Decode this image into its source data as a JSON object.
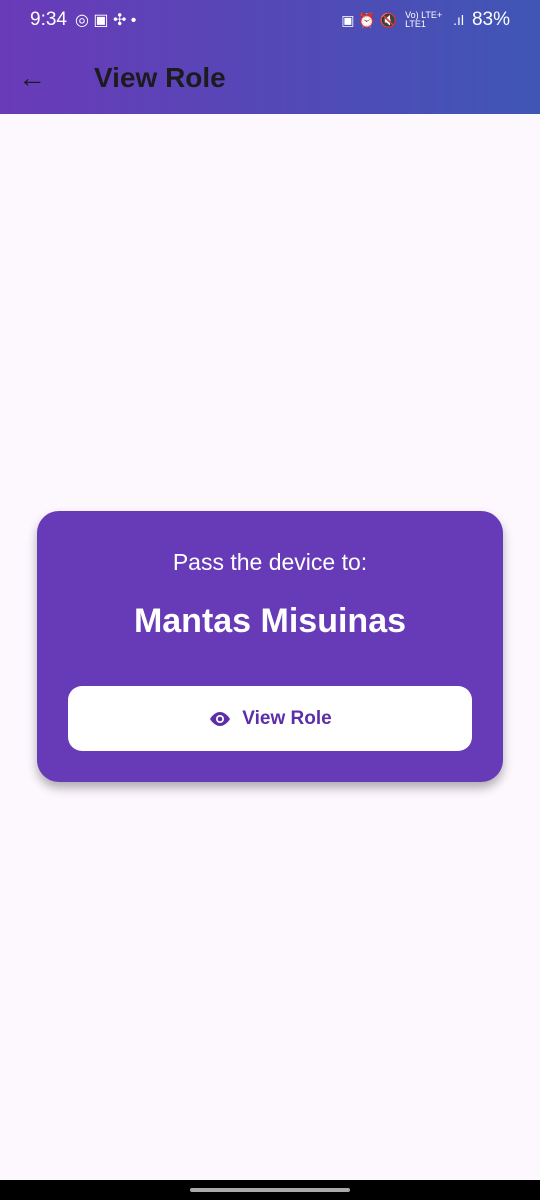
{
  "status": {
    "time": "9:34",
    "network": "Vo) LTE+ LTE1",
    "battery": "83%"
  },
  "appbar": {
    "title": "View Role",
    "back_icon": "arrow-left-icon"
  },
  "card": {
    "prompt": "Pass the device to:",
    "player_name": "Mantas Misuinas",
    "button_label": "View Role",
    "button_icon": "eye-icon"
  },
  "colors": {
    "card": "#673ab7",
    "background": "#fdf7fe"
  }
}
